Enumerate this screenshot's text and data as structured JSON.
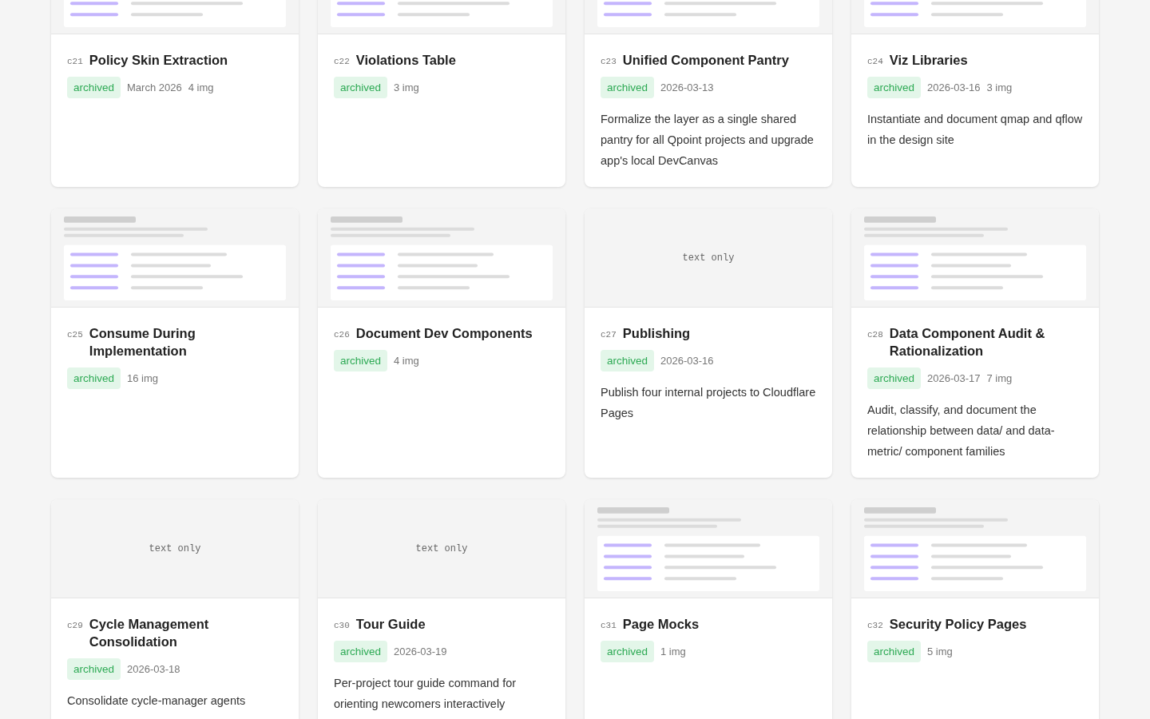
{
  "cards": [
    {
      "code": "c21",
      "title": "Policy Skin Extraction",
      "status": "archived",
      "date": "March 2026",
      "images": "4 img",
      "thumbnail": {
        "kind": "image"
      }
    },
    {
      "code": "c22",
      "title": "Violations Table",
      "status": "archived",
      "images": "3 img",
      "thumbnail": {
        "kind": "image"
      }
    },
    {
      "code": "c23",
      "title": "Unified Component Pantry",
      "status": "archived",
      "date": "2026-03-13",
      "description": "Formalize the layer as a single shared pantry for all Qpoint projects and upgrade app's local DevCanvas",
      "thumbnail": {
        "kind": "image"
      }
    },
    {
      "code": "c24",
      "title": "Viz Libraries",
      "status": "archived",
      "date": "2026-03-16",
      "images": "3 img",
      "description": "Instantiate and document qmap and qflow in the design site",
      "thumbnail": {
        "kind": "image"
      }
    },
    {
      "code": "c25",
      "title": "Consume During Implementation",
      "status": "archived",
      "images": "16 img",
      "thumbnail": {
        "kind": "image"
      }
    },
    {
      "code": "c26",
      "title": "Document Dev Components",
      "status": "archived",
      "images": "4 img",
      "thumbnail": {
        "kind": "image"
      }
    },
    {
      "code": "c27",
      "title": "Publishing",
      "status": "archived",
      "date": "2026-03-16",
      "description": "Publish four internal projects to Cloudflare Pages",
      "thumbnail": {
        "kind": "text",
        "label": "text only"
      }
    },
    {
      "code": "c28",
      "title": "Data Component Audit & Rationalization",
      "status": "archived",
      "date": "2026-03-17",
      "images": "7 img",
      "description": "Audit, classify, and document the relationship between data/ and data-metric/ component families",
      "thumbnail": {
        "kind": "image"
      }
    },
    {
      "code": "c29",
      "title": "Cycle Management Consolidation",
      "status": "archived",
      "date": "2026-03-18",
      "description": "Consolidate cycle-manager agents",
      "thumbnail": {
        "kind": "text",
        "label": "text only"
      }
    },
    {
      "code": "c30",
      "title": "Tour Guide",
      "status": "archived",
      "date": "2026-03-19",
      "description": "Per-project tour guide command for orienting newcomers interactively",
      "thumbnail": {
        "kind": "text",
        "label": "text only"
      }
    },
    {
      "code": "c31",
      "title": "Page Mocks",
      "status": "archived",
      "images": "1 img",
      "thumbnail": {
        "kind": "image"
      }
    },
    {
      "code": "c32",
      "title": "Security Policy Pages",
      "status": "archived",
      "images": "5 img",
      "thumbnail": {
        "kind": "image"
      }
    }
  ]
}
